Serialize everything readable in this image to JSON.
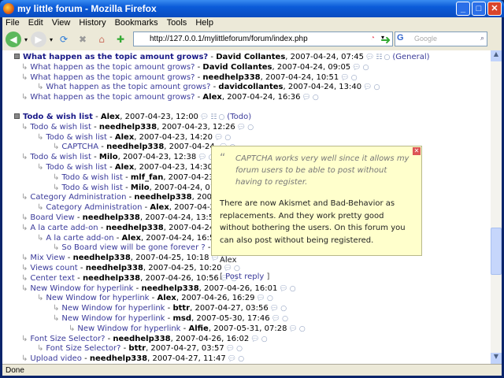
{
  "window": {
    "title": "my little forum - Mozilla Firefox"
  },
  "menu": [
    "File",
    "Edit",
    "View",
    "History",
    "Bookmarks",
    "Tools",
    "Help"
  ],
  "url": "http://127.0.0.1/mylittleforum/forum/index.php",
  "search_placeholder": "Google",
  "status": "Done",
  "posts": [
    {
      "level": 0,
      "title": "What happen as the topic amount grows?",
      "author": "David Collantes",
      "date": "2007-04-24, 07:45",
      "category": "(General)"
    },
    {
      "level": 1,
      "title": "What happen as the topic amount grows?",
      "author": "David Collantes",
      "date": "2007-04-24, 09:05"
    },
    {
      "level": 1,
      "title": "What happen as the topic amount grows?",
      "author": "needhelp338",
      "date": "2007-04-24, 10:51"
    },
    {
      "level": 2,
      "title": "What happen as the topic amount grows?",
      "author": "davidcollantes",
      "date": "2007-04-24, 13:40"
    },
    {
      "level": 1,
      "title": "What happen as the topic amount grows?",
      "author": "Alex",
      "date": "2007-04-24, 16:36"
    },
    {
      "gap": true,
      "level": 0,
      "title": "Todo & wish list",
      "author": "Alex",
      "date": "2007-04-23, 12:00",
      "category": "(Todo)"
    },
    {
      "level": 1,
      "title": "Todo & wish list",
      "author": "needhelp338",
      "date": "2007-04-23, 12:26"
    },
    {
      "level": 2,
      "title": "Todo & wish list",
      "author": "Alex",
      "date": "2007-04-23, 14:20"
    },
    {
      "level": 3,
      "title": "CAPTCHA",
      "author": "needhelp338",
      "date": "2007-04-24,"
    },
    {
      "level": 1,
      "title": "Todo & wish list",
      "author": "Milo",
      "date": "2007-04-23, 12:38"
    },
    {
      "level": 2,
      "title": "Todo & wish list",
      "author": "Alex",
      "date": "2007-04-23, 14:30"
    },
    {
      "level": 3,
      "title": "Todo & wish list",
      "author": "mlf_fan",
      "date": "2007-04-23"
    },
    {
      "level": 3,
      "title": "Todo & wish list",
      "author": "Milo",
      "date": "2007-04-24, 01"
    },
    {
      "level": 1,
      "title": "Category Administration",
      "author": "needhelp338",
      "date": "2007-0"
    },
    {
      "level": 2,
      "title": "Category Administration",
      "author": "Alex",
      "date": "2007-04-24"
    },
    {
      "level": 1,
      "title": "Board View",
      "author": "needhelp338",
      "date": "2007-04-24, 13:51"
    },
    {
      "level": 1,
      "title": "A la carte add-on",
      "author": "needhelp338",
      "date": "2007-04-24,"
    },
    {
      "level": 2,
      "title": "A la carte add-on",
      "author": "Alex",
      "date": "2007-04-24, 16:5"
    },
    {
      "level": 3,
      "title": "So Board view will be gone forever ?",
      "author": "r",
      "date": ""
    },
    {
      "level": 1,
      "title": "Mix View",
      "author": "needhelp338",
      "date": "2007-04-25, 10:18"
    },
    {
      "level": 1,
      "title": "Views count",
      "author": "needhelp338",
      "date": "2007-04-25, 10:20"
    },
    {
      "level": 1,
      "title": "Center text",
      "author": "needhelp338",
      "date": "2007-04-26, 10:56"
    },
    {
      "level": 1,
      "title": "New Window for hyperlink",
      "author": "needhelp338",
      "date": "2007-04-26, 16:01"
    },
    {
      "level": 2,
      "title": "New Window for hyperlink",
      "author": "Alex",
      "date": "2007-04-26, 16:29"
    },
    {
      "level": 3,
      "title": "New Window for hyperlink",
      "author": "bttr",
      "date": "2007-04-27, 03:56"
    },
    {
      "level": 3,
      "title": "New Window for hyperlink",
      "author": "msd",
      "date": "2007-05-30, 17:46"
    },
    {
      "level": 4,
      "title": "New Window for hyperlink",
      "author": "Alfie",
      "date": "2007-05-31, 07:28"
    },
    {
      "level": 1,
      "title": "Font Size Selector?",
      "author": "needhelp338",
      "date": "2007-04-26, 16:02"
    },
    {
      "level": 2,
      "title": "Font Size Selector?",
      "author": "bttr",
      "date": "2007-04-27, 03:57"
    },
    {
      "level": 1,
      "title": "Upload video",
      "author": "needhelp338",
      "date": "2007-04-27, 11:47"
    }
  ],
  "popup": {
    "quote": "CAPTCHA works very well since it allows my forum users to be able to post without having to register.",
    "body": "There are now Akismet and Bad-Behavior as replacements. And they work pretty good without bothering the users. On this forum you can also post without being registered.",
    "signature": "Alex",
    "reply_open": "[",
    "reply_label": "Post reply",
    "reply_close": "]"
  }
}
